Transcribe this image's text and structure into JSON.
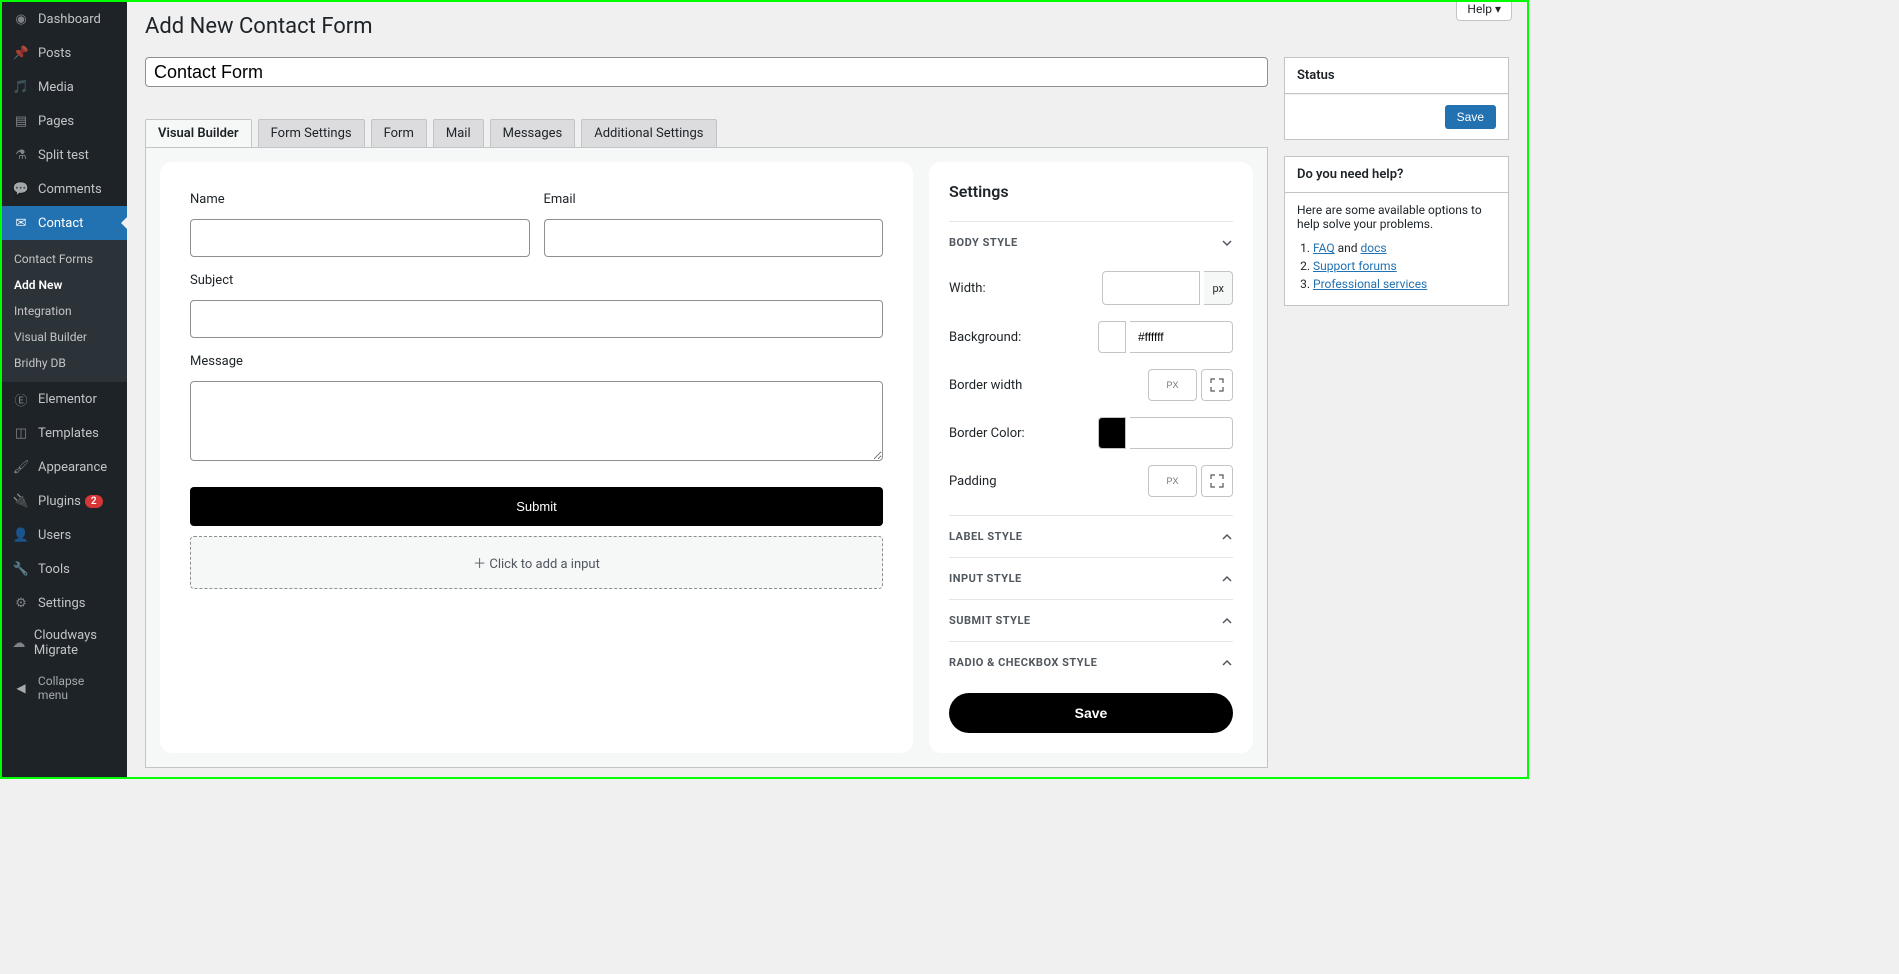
{
  "sidebar": {
    "items": [
      {
        "label": "Dashboard",
        "icon": "dashboard"
      },
      {
        "label": "Posts",
        "icon": "pin"
      },
      {
        "label": "Media",
        "icon": "media"
      },
      {
        "label": "Pages",
        "icon": "pages"
      },
      {
        "label": "Split test",
        "icon": "split"
      },
      {
        "label": "Comments",
        "icon": "comment"
      },
      {
        "label": "Contact",
        "icon": "mail",
        "active": true
      },
      {
        "label": "Elementor",
        "icon": "elementor"
      },
      {
        "label": "Templates",
        "icon": "templates"
      },
      {
        "label": "Appearance",
        "icon": "brush"
      },
      {
        "label": "Plugins",
        "icon": "plug",
        "badge": "2"
      },
      {
        "label": "Users",
        "icon": "user"
      },
      {
        "label": "Tools",
        "icon": "wrench"
      },
      {
        "label": "Settings",
        "icon": "sliders"
      },
      {
        "label": "Cloudways Migrate",
        "icon": "cloud"
      }
    ],
    "submenu": [
      {
        "label": "Contact Forms"
      },
      {
        "label": "Add New",
        "current": true
      },
      {
        "label": "Integration"
      },
      {
        "label": "Visual Builder"
      },
      {
        "label": "Bridhy DB"
      }
    ],
    "collapse": "Collapse menu"
  },
  "header": {
    "title": "Add New Contact Form",
    "help": "Help"
  },
  "title_input": "Contact Form",
  "tabs": [
    {
      "label": "Visual Builder",
      "active": true
    },
    {
      "label": "Form Settings"
    },
    {
      "label": "Form"
    },
    {
      "label": "Mail"
    },
    {
      "label": "Messages"
    },
    {
      "label": "Additional Settings"
    }
  ],
  "form": {
    "fields": {
      "name": "Name",
      "email": "Email",
      "subject": "Subject",
      "message": "Message"
    },
    "submit": "Submit",
    "add_input": "Click to add a input"
  },
  "settings": {
    "title": "Settings",
    "sections": {
      "body": "BODY STYLE",
      "label": "LABEL STYLE",
      "input": "INPUT STYLE",
      "submit": "SUBMIT STYLE",
      "radio": "RADIO & CHECKBOX STYLE"
    },
    "body": {
      "width_label": "Width:",
      "width_unit": "px",
      "background_label": "Background:",
      "background_value": "#ffffff",
      "border_width_label": "Border width",
      "border_width_unit": "PX",
      "border_color_label": "Border Color:",
      "border_color_swatch": "#000000",
      "padding_label": "Padding",
      "padding_unit": "PX"
    },
    "save": "Save"
  },
  "status_box": {
    "title": "Status",
    "save": "Save"
  },
  "help_box": {
    "title": "Do you need help?",
    "intro": "Here are some available options to help solve your problems.",
    "faq": "FAQ",
    "and": " and ",
    "docs": "docs",
    "support": "Support forums",
    "pro": "Professional services"
  }
}
